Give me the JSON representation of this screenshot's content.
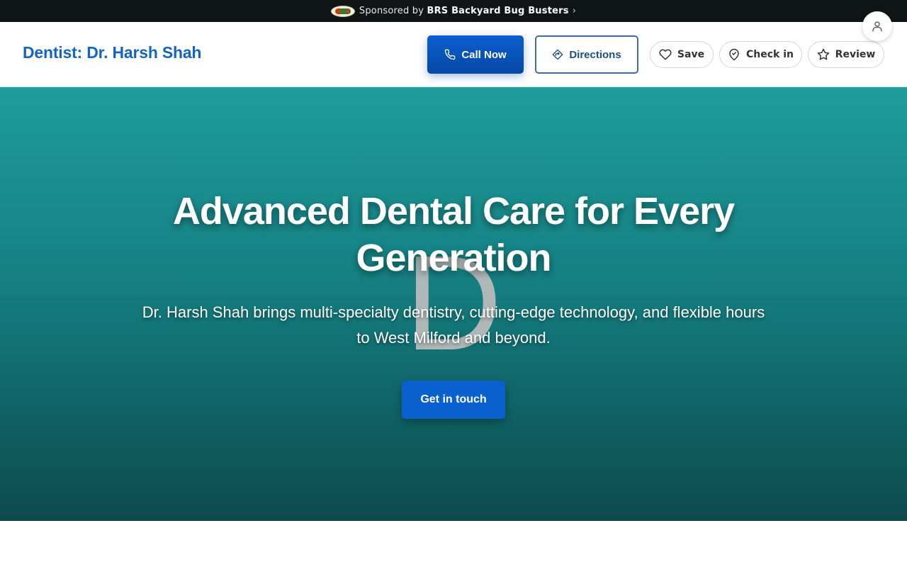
{
  "sponsor": {
    "prefix": "Sponsored by",
    "name": "BRS Backyard Bug Busters",
    "chevron": "›",
    "logo_icon": "sponsor-logo-icon"
  },
  "header": {
    "title": "Dentist: Dr. Harsh Shah",
    "title_color": "#1565c0",
    "call_label": "Call Now",
    "directions_label": "Directions",
    "save_label": "Save",
    "checkin_label": "Check in",
    "review_label": "Review"
  },
  "hero": {
    "title": "Advanced Dental Care for Every Generation",
    "subtitle": "Dr. Harsh Shah brings multi-specialty dentistry, cutting-edge technology, and flexible hours to West Milford and beyond.",
    "watermark": "D",
    "cta_label": "Get in touch",
    "accent_color": "#0b60cf",
    "background_color": "#168385"
  }
}
